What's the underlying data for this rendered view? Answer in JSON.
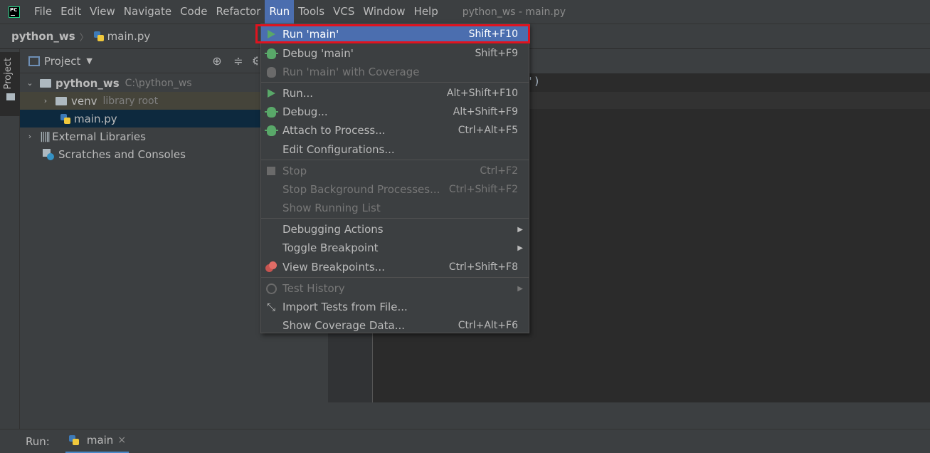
{
  "app": {
    "logo_text": "PC",
    "window_title": "python_ws - main.py"
  },
  "menubar": {
    "items": [
      "File",
      "Edit",
      "View",
      "Navigate",
      "Code",
      "Refactor",
      "Run",
      "Tools",
      "VCS",
      "Window",
      "Help"
    ],
    "active": "Run"
  },
  "breadcrumb": {
    "root": "python_ws",
    "file": "main.py"
  },
  "tool_stripe": {
    "project_tab": "Project"
  },
  "project_panel": {
    "title": "Project",
    "tree": {
      "root_name": "python_ws",
      "root_path": "C:\\python_ws",
      "venv_name": "venv",
      "venv_note": "library root",
      "file_name": "main.py",
      "external": "External Libraries",
      "scratches": "Scratches and Consoles"
    }
  },
  "editor": {
    "visible_code_tail": "')"
  },
  "run_menu": {
    "items": [
      {
        "label": "Run 'main'",
        "shortcut": "Shift+F10",
        "state": "highlighted",
        "icon": "run-icon"
      },
      {
        "label": "Debug 'main'",
        "shortcut": "Shift+F9",
        "state": "enabled",
        "icon": "debug-icon"
      },
      {
        "label": "Run 'main' with Coverage",
        "shortcut": "",
        "state": "disabled",
        "icon": "coverage-icon"
      },
      {
        "label": "Run...",
        "shortcut": "Alt+Shift+F10",
        "state": "enabled",
        "icon": "run-icon"
      },
      {
        "label": "Debug...",
        "shortcut": "Alt+Shift+F9",
        "state": "enabled",
        "icon": "debug-icon"
      },
      {
        "label": "Attach to Process...",
        "shortcut": "Ctrl+Alt+F5",
        "state": "enabled",
        "icon": "attach-icon"
      },
      {
        "label": "Edit Configurations...",
        "shortcut": "",
        "state": "enabled",
        "icon": ""
      },
      {
        "label": "Stop",
        "shortcut": "Ctrl+F2",
        "state": "disabled",
        "icon": "stop-icon"
      },
      {
        "label": "Stop Background Processes...",
        "shortcut": "Ctrl+Shift+F2",
        "state": "disabled",
        "icon": ""
      },
      {
        "label": "Show Running List",
        "shortcut": "",
        "state": "disabled",
        "icon": ""
      },
      {
        "label": "Debugging Actions",
        "shortcut": "",
        "state": "submenu",
        "icon": ""
      },
      {
        "label": "Toggle Breakpoint",
        "shortcut": "",
        "state": "submenu",
        "icon": ""
      },
      {
        "label": "View Breakpoints...",
        "shortcut": "Ctrl+Shift+F8",
        "state": "enabled",
        "icon": "breakpoints-icon"
      },
      {
        "label": "Test History",
        "shortcut": "",
        "state": "disabled-submenu",
        "icon": "clock-icon"
      },
      {
        "label": "Import Tests from File...",
        "shortcut": "",
        "state": "enabled",
        "icon": "import-icon"
      },
      {
        "label": "Show Coverage Data...",
        "shortcut": "Ctrl+Alt+F6",
        "state": "enabled",
        "icon": ""
      }
    ]
  },
  "run_bar": {
    "label": "Run:",
    "tab": "main",
    "close_glyph": "×"
  },
  "colors": {
    "highlight": "#4b6eaf",
    "annotation_box": "#e0131f",
    "panel": "#3c3f41",
    "editor": "#2b2b2b"
  }
}
